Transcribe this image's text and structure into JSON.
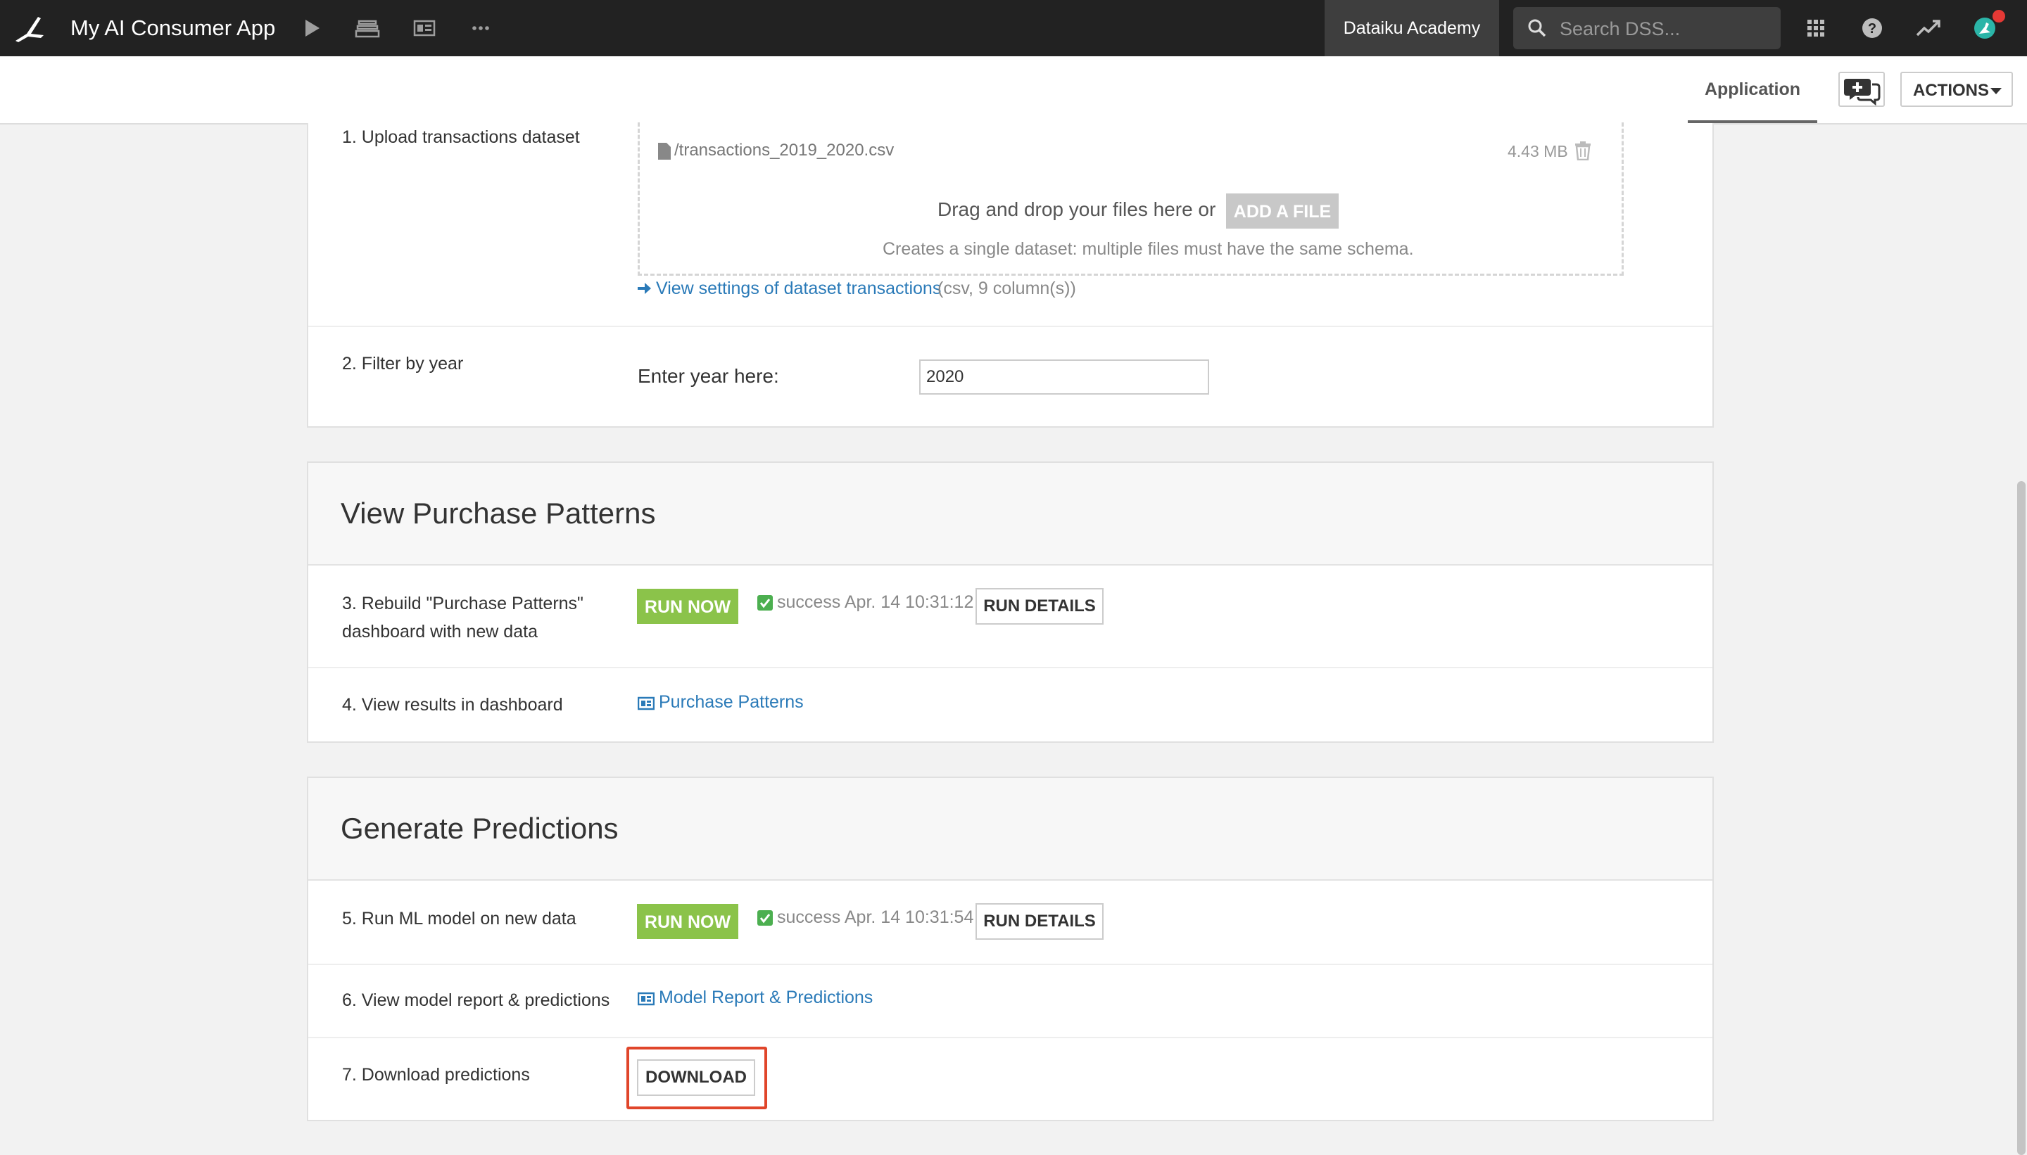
{
  "topbar": {
    "app_title": "My AI Consumer App",
    "academy_label": "Dataiku Academy",
    "search_placeholder": "Search DSS..."
  },
  "subbar": {
    "tab_application": "Application",
    "actions_label": "ACTIONS"
  },
  "upload": {
    "step_label": "1. Upload transactions dataset",
    "file_name": "/transactions_2019_2020.csv",
    "file_size": "4.43 MB",
    "drop_text": "Drag and drop your files here or",
    "add_file_label": "ADD A FILE",
    "schema_note": "Creates a single dataset: multiple files must have the same schema.",
    "settings_link": "View settings of dataset transactions",
    "settings_meta": "(csv, 9 column(s))"
  },
  "filter": {
    "step_label": "2. Filter by year",
    "year_label": "Enter year here:",
    "year_value": "2020"
  },
  "purchase_patterns": {
    "title": "View Purchase Patterns",
    "step3_label": "3. Rebuild \"Purchase Patterns\"",
    "step3_label_line2": "dashboard with new data",
    "run_now_label": "RUN NOW",
    "status_text": "success Apr. 14 10:31:12",
    "run_details_label": "RUN DETAILS",
    "step4_label": "4. View results in dashboard",
    "dashboard_link": "Purchase Patterns"
  },
  "predictions": {
    "title": "Generate Predictions",
    "step5_label": "5. Run ML model on new data",
    "run_now_label": "RUN NOW",
    "status_text": "success Apr. 14 10:31:54",
    "run_details_label": "RUN DETAILS",
    "step6_label": "6. View model report & predictions",
    "report_link": "Model Report & Predictions",
    "step7_label": "7. Download predictions",
    "download_label": "DOWNLOAD"
  },
  "colors": {
    "topbar_bg": "#222222",
    "run_now_green": "#8bc34a",
    "link_blue": "#2a7ab8",
    "highlight_red": "#e0452a",
    "notification_red": "#e53935",
    "success_green": "#4caf50"
  },
  "icons": [
    "bird-logo-icon",
    "play-icon",
    "stack-icon",
    "dashboard-icon",
    "more-icon",
    "search-icon",
    "grid-apps-icon",
    "help-icon",
    "trend-icon",
    "user-avatar-icon",
    "discussion-icon",
    "file-icon",
    "trash-icon",
    "arrow-right-icon",
    "check-icon"
  ]
}
